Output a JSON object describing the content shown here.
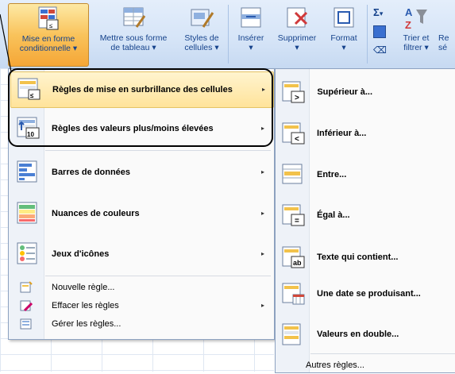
{
  "ribbon": {
    "buttons": [
      {
        "line1": "Mise en forme",
        "line2": "conditionnelle",
        "dropdown": true,
        "icon": "conditional-format-icon"
      },
      {
        "line1": "Mettre sous forme",
        "line2": "de tableau",
        "dropdown": true,
        "icon": "format-table-icon"
      },
      {
        "line1": "Styles de",
        "line2": "cellules",
        "dropdown": true,
        "icon": "cell-styles-icon"
      },
      {
        "line1": "Insérer",
        "line2": "",
        "dropdown": true,
        "icon": "insert-icon"
      },
      {
        "line1": "Supprimer",
        "line2": "",
        "dropdown": true,
        "icon": "delete-icon"
      },
      {
        "line1": "Format",
        "line2": "",
        "dropdown": true,
        "icon": "format-icon"
      },
      {
        "line1": "Trier et",
        "line2": "filtrer",
        "dropdown": true,
        "icon": "sort-filter-icon"
      },
      {
        "line1": "Re",
        "line2": "sé",
        "dropdown": false,
        "icon": "find-select-icon"
      }
    ],
    "dropdown_glyph": "▾",
    "sigma": "Σ",
    "sigma_caret": "▾"
  },
  "menu": {
    "items": [
      {
        "label": "Règles de mise en surbrillance des cellules",
        "icon": "highlight-rules-icon",
        "submenu": true
      },
      {
        "label": "Règles des valeurs plus/moins élevées",
        "icon": "top-bottom-rules-icon",
        "submenu": true
      },
      {
        "label": "Barres de données",
        "icon": "data-bars-icon",
        "submenu": true
      },
      {
        "label": "Nuances de couleurs",
        "icon": "color-scales-icon",
        "submenu": true
      },
      {
        "label": "Jeux d'icônes",
        "icon": "icon-sets-icon",
        "submenu": true
      }
    ],
    "small_items": [
      {
        "label": "Nouvelle règle...",
        "icon": "new-rule-icon",
        "submenu": false
      },
      {
        "label": "Effacer les règles",
        "icon": "clear-rules-icon",
        "submenu": true
      },
      {
        "label": "Gérer les règles...",
        "icon": "manage-rules-icon",
        "submenu": false
      }
    ],
    "arrow_glyph": "▸"
  },
  "submenu": {
    "items": [
      {
        "label": "Supérieur à...",
        "symbol": ">"
      },
      {
        "label": "Inférieur à...",
        "symbol": "<"
      },
      {
        "label": "Entre...",
        "symbol": ""
      },
      {
        "label": "Égal à...",
        "symbol": "="
      },
      {
        "label": "Texte qui contient...",
        "symbol": "ab"
      },
      {
        "label": "Une date se produisant...",
        "symbol": ""
      },
      {
        "label": "Valeurs en double...",
        "symbol": ""
      }
    ],
    "more": "Autres règles..."
  },
  "colors": {
    "ribbon_text": "#15428b",
    "highlight": "#ffe39a",
    "callout": "#000000"
  }
}
